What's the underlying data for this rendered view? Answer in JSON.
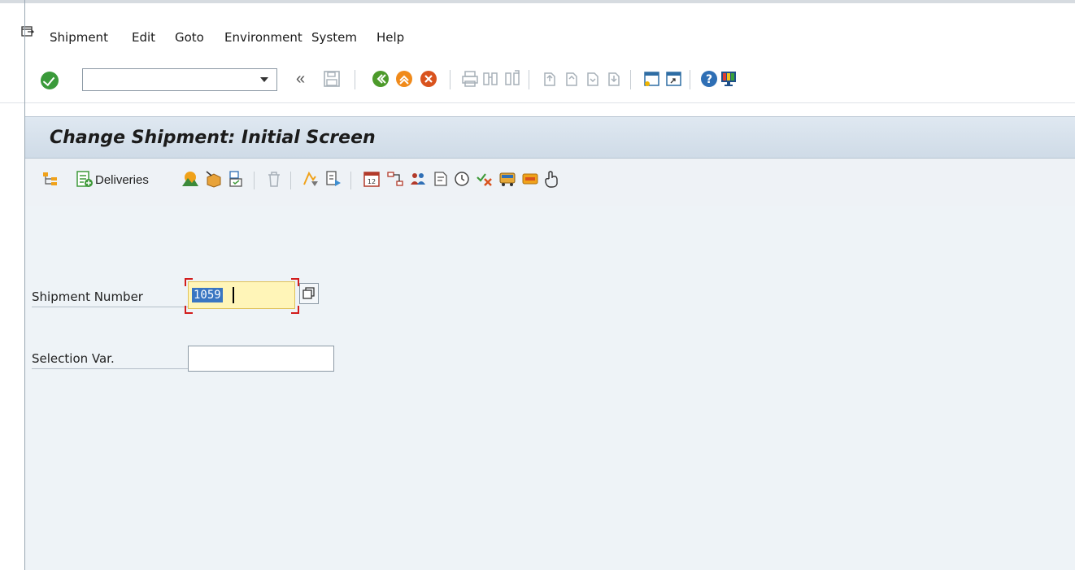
{
  "menubar": {
    "items": [
      {
        "label": "Shipment",
        "access_key": "t"
      },
      {
        "label": "Edit",
        "access_key": "E"
      },
      {
        "label": "Goto",
        "access_key": "G"
      },
      {
        "label": "Environment",
        "access_key": "v"
      },
      {
        "label": "System",
        "access_key": "y"
      },
      {
        "label": "Help",
        "access_key": "H"
      }
    ]
  },
  "system_toolbar": {
    "command_field_value": "",
    "back_chevron": "«"
  },
  "title": "Change Shipment: Initial Screen",
  "app_toolbar": {
    "deliveries_label": "Deliveries"
  },
  "form": {
    "shipment_number_label": "Shipment Number",
    "shipment_number_value": "1059",
    "selection_var_label": "Selection Var.",
    "selection_var_value": ""
  },
  "colors": {
    "title_bg": "#dfe8f1",
    "main_bg": "#eef3f7",
    "input_focus_bg": "#fff5b8",
    "focus_marker": "#d21c1c",
    "ok_green": "#3a9a3a"
  }
}
